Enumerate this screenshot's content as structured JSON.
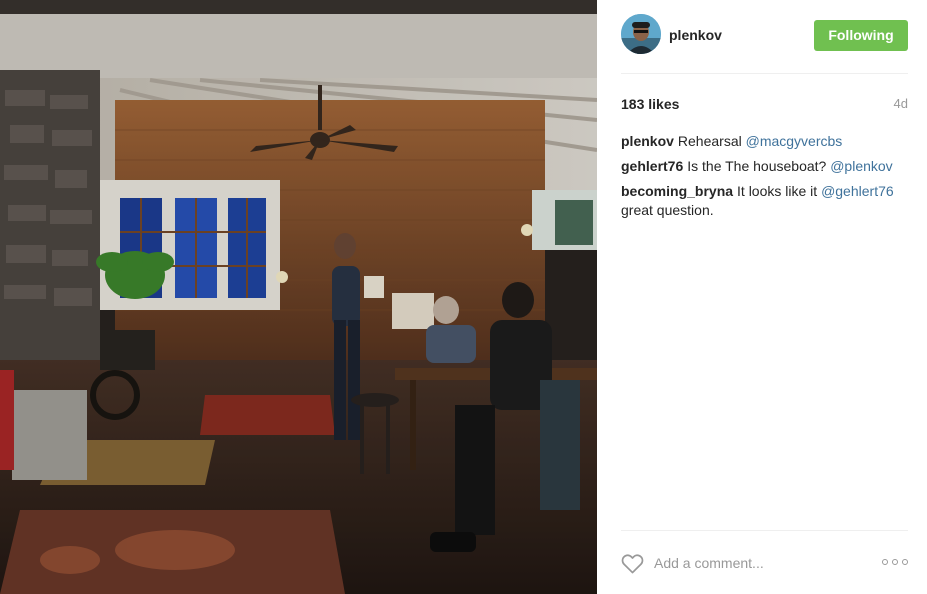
{
  "post": {
    "username": "plenkov",
    "follow_label": "Following",
    "likes": "183 likes",
    "age": "4d",
    "add_comment_placeholder": "Add a comment...",
    "colors": {
      "accent_green": "#70c050",
      "mention_blue": "#3f729b",
      "muted": "#999999"
    }
  },
  "comments": [
    {
      "author": "plenkov",
      "parts": [
        "Rehearsal ",
        "@macgyvercbs"
      ]
    },
    {
      "author": "gehlert76",
      "parts": [
        "Is the The houseboat? ",
        "@plenkov"
      ]
    },
    {
      "author": "becoming_bryna",
      "parts": [
        "It looks like it ",
        "@gehlert76",
        " great question."
      ]
    }
  ],
  "icons": {
    "heart": "heart-outline-icon",
    "more": "more-options-icon"
  }
}
